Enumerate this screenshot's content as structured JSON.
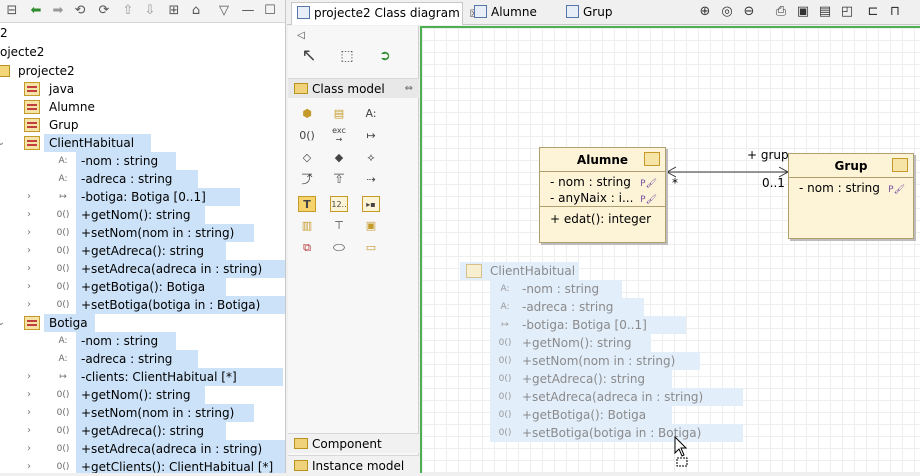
{
  "left_tree": {
    "root_fragment": "2",
    "project_fragment": "ojecte2",
    "package": "projecte2",
    "items": [
      {
        "label": "java",
        "kind": "class"
      },
      {
        "label": "Alumne",
        "kind": "class"
      },
      {
        "label": "Grup",
        "kind": "class"
      },
      {
        "label": "ClientHabitual",
        "kind": "class",
        "selected": true
      },
      {
        "label": "-nom : string",
        "kind": "attr",
        "selected": true
      },
      {
        "label": "-adreca : string",
        "kind": "attr",
        "selected": true
      },
      {
        "label": "-botiga: Botiga [0..1]",
        "kind": "assoc",
        "selected": true
      },
      {
        "label": "+getNom(): string",
        "kind": "op",
        "selected": true
      },
      {
        "label": "+setNom(nom in : string)",
        "kind": "op",
        "selected": true
      },
      {
        "label": "+getAdreca(): string",
        "kind": "op",
        "selected": true
      },
      {
        "label": "+setAdreca(adreca in : string)",
        "kind": "op",
        "selected": true
      },
      {
        "label": "+getBotiga(): Botiga",
        "kind": "op",
        "selected": true
      },
      {
        "label": "+setBotiga(botiga in : Botiga)",
        "kind": "op",
        "selected": true
      },
      {
        "label": "Botiga",
        "kind": "class",
        "selected": true
      },
      {
        "label": "-nom : string",
        "kind": "attr",
        "selected": true
      },
      {
        "label": "-adreca : string",
        "kind": "attr",
        "selected": true
      },
      {
        "label": "-clients: ClientHabitual [*]",
        "kind": "assoc",
        "selected": true
      },
      {
        "label": "+getNom(): string",
        "kind": "op",
        "selected": true
      },
      {
        "label": "+setNom(nom in : string)",
        "kind": "op",
        "selected": true
      },
      {
        "label": "+getAdreca(): string",
        "kind": "op",
        "selected": true
      },
      {
        "label": "+setAdreca(adreca in : string)",
        "kind": "op",
        "selected": true
      },
      {
        "label": "+getClients(): ClientHabitual [*]",
        "kind": "op",
        "selected": true
      }
    ]
  },
  "tabs": [
    {
      "label": "projecte2 Class diagram",
      "active": true,
      "close": "☒"
    },
    {
      "label": "Alumne",
      "active": false
    },
    {
      "label": "Grup",
      "active": false
    }
  ],
  "palette": {
    "drawer_open": "Class model",
    "drawers_bottom": [
      "Component model",
      "Instance model"
    ],
    "stereo_glyph": "exc",
    "pin_glyph": "⇔"
  },
  "diagram": {
    "alumne": {
      "name": "Alumne",
      "attrs": [
        "- nom : string",
        "- anyNaix : i..."
      ],
      "ops": [
        "+ edat(): integer"
      ]
    },
    "grup": {
      "name": "Grup",
      "attrs": [
        "- nom : string"
      ]
    },
    "assoc": {
      "role": "+ grup",
      "mult_right": "0..1",
      "mult_left": "*"
    },
    "ghost": {
      "name": "ClientHabitual",
      "rows": [
        "-nom : string",
        "-adreca : string",
        "-botiga: Botiga [0..1]",
        "+getNom(): string",
        "+setNom(nom in : string)",
        "+getAdreca(): string",
        "+setAdreca(adreca in : string)",
        "+getBotiga(): Botiga",
        "+setBotiga(botiga in : Botiga)"
      ]
    }
  }
}
